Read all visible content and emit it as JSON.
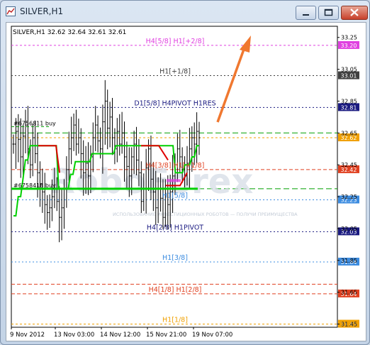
{
  "window": {
    "title": "SILVER,H1",
    "icons": {
      "app": "chart-app-icon",
      "minimize": "minimize-icon",
      "maximize": "maximize-icon",
      "close": "close-icon"
    }
  },
  "chart_header": "SILVER,H1  32.62 32.64 32.61 32.61",
  "watermark": "RoboForex",
  "watermark_sub": "ИСПОЛЬЗОВАНИЕ ИНВЕСТИЦИОННЫХ РОБОТОВ — ПОЛУЧИ ПРЕИМУЩЕСТВА",
  "colors": {
    "background": "#ffffff",
    "frame": "#000000",
    "bars": "#000000",
    "green_line": "#00d000",
    "red_line": "#e00000",
    "arrow": "#f07830"
  },
  "chart_data": {
    "type": "line",
    "title": "SILVER,H1",
    "ylim": [
      31.43,
      33.32
    ],
    "y_tick_labels": [
      "33.25",
      "33.05",
      "32.85",
      "32.65",
      "32.45",
      "32.25",
      "32.05",
      "31.85",
      "31.65",
      "31.45"
    ],
    "x_tick_labels": [
      "9 Nov 2012",
      "13 Nov 03:00",
      "14 Nov 12:00",
      "15 Nov 21:00",
      "19 Nov 07:00"
    ],
    "levels": [
      {
        "value": 33.2,
        "badge": "33.20",
        "label": "H4[5/8] H1[+2/8]",
        "color": "#e040e0"
      },
      {
        "value": 33.01,
        "badge": "33.01",
        "label": "H1[+1/8]",
        "color": "#404040"
      },
      {
        "value": 32.81,
        "badge": "32.81",
        "label": "D1[5/8] H4PIVOT H1RES",
        "color": "#1a1a80"
      },
      {
        "value": 32.65,
        "badge": "",
        "label": "",
        "color": "#00a000"
      },
      {
        "value": 32.62,
        "badge": "32.62",
        "label": "",
        "color": "#f0a000"
      },
      {
        "value": 32.42,
        "badge": "32.42",
        "label": "H4[3/8] H1[+1/8]",
        "color": "#e04020"
      },
      {
        "value": 32.3,
        "badge": "",
        "label": "",
        "color": "#00a000"
      },
      {
        "value": 32.23,
        "badge": "32.23",
        "label": "H1[5/8]",
        "color": "#3c8ce0"
      },
      {
        "value": 32.03,
        "badge": "32.03",
        "label": "H4[2/8] H1PIVOT",
        "color": "#1a1a80"
      },
      {
        "value": 31.84,
        "badge": "31.84",
        "label": "H1[3/8]",
        "color": "#3c8ce0"
      },
      {
        "value": 31.7,
        "badge": "",
        "label": "",
        "color": "#e04020"
      },
      {
        "value": 31.64,
        "badge": "31.64",
        "label": "H4[1/8] H1[2/8]",
        "color": "#e04020"
      },
      {
        "value": 31.45,
        "badge": "31.45",
        "label": "H1[1/8]",
        "color": "#f0a000"
      }
    ],
    "orders": [
      {
        "label": "#6756811 buy",
        "price": 32.69
      },
      {
        "label": "#6758418 buy",
        "price": 32.3
      }
    ],
    "bars_close": [
      32.58,
      32.66,
      32.61,
      32.5,
      32.63,
      32.7,
      32.55,
      32.45,
      32.62,
      32.52,
      32.4,
      32.33,
      32.28,
      32.2,
      32.15,
      32.18,
      32.25,
      32.3,
      32.22,
      32.12,
      32.18,
      32.3,
      32.42,
      32.55,
      32.62,
      32.7,
      32.58,
      32.62,
      32.52,
      32.4,
      32.46,
      32.38,
      32.5,
      32.62,
      32.7,
      32.6,
      32.55,
      32.72,
      32.85,
      32.68,
      32.75,
      32.62,
      32.55,
      32.66,
      32.58,
      32.65,
      32.5,
      32.44,
      32.38,
      32.5,
      32.58,
      32.48,
      32.4,
      32.22,
      32.3,
      32.43,
      32.55,
      32.36,
      32.28,
      32.18,
      32.3,
      32.24,
      32.12,
      32.3,
      32.2,
      32.28,
      32.38,
      32.45,
      32.55,
      32.5,
      32.42,
      32.38,
      32.46,
      32.55,
      32.62,
      32.58,
      32.66,
      32.62
    ],
    "series": [
      {
        "color": "#00d000",
        "values": [
          32.13,
          32.13,
          32.25,
          32.25,
          32.36,
          32.48,
          32.48,
          32.57,
          32.57,
          32.57,
          32.57,
          32.57,
          32.57,
          32.57,
          32.57,
          32.57,
          32.57,
          32.57,
          32.57,
          32.3,
          32.3,
          32.3,
          32.3,
          32.3,
          32.39,
          32.39,
          32.47,
          32.47,
          32.47,
          32.47,
          32.47,
          32.47,
          32.47,
          32.52,
          32.52,
          32.52,
          32.52,
          32.52,
          32.52,
          32.52,
          32.52,
          32.52,
          32.52,
          32.57,
          32.57,
          32.57,
          32.57,
          32.57,
          32.57,
          32.57,
          32.57,
          32.57,
          32.57,
          32.57,
          32.57,
          32.57,
          32.57,
          32.57,
          32.57,
          32.57,
          32.57,
          32.57,
          32.57,
          32.57,
          32.57,
          32.57,
          32.57,
          32.57,
          32.4,
          32.4,
          32.4,
          32.4,
          32.45,
          32.45,
          32.45,
          32.5,
          32.5,
          32.57,
          32.57
        ]
      }
    ]
  }
}
